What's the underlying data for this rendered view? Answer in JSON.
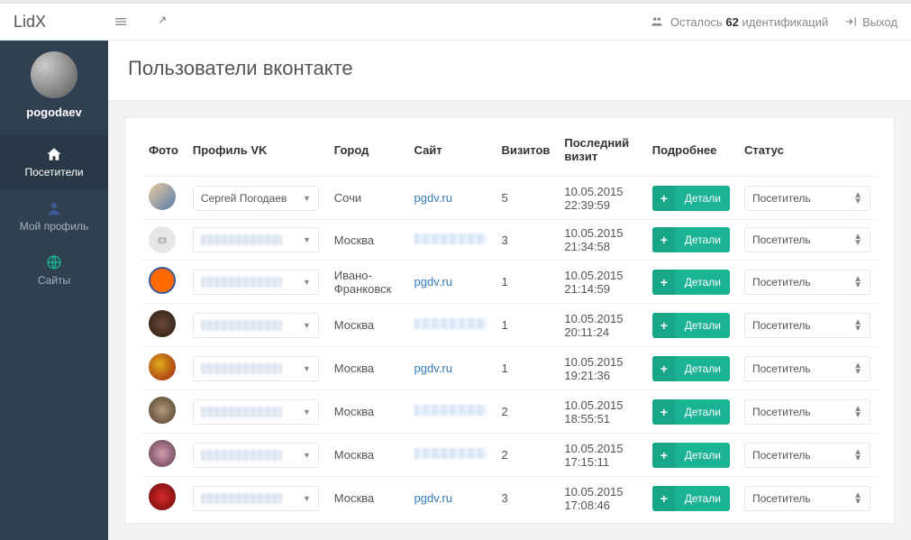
{
  "brand": "LidX",
  "topbar": {
    "remaining_prefix": "Осталось",
    "remaining_count": "62",
    "remaining_suffix": "идентификаций",
    "logout": "Выход"
  },
  "sidebar": {
    "username": "pogodaev",
    "items": [
      {
        "label": "Посетители"
      },
      {
        "label": "Мой профиль"
      },
      {
        "label": "Сайты"
      }
    ]
  },
  "page_title": "Пользователи вконтакте",
  "table": {
    "headers": {
      "photo": "Фото",
      "profile": "Профиль VK",
      "city": "Город",
      "site": "Сайт",
      "visits": "Визитов",
      "last_visit": "Последний визит",
      "more": "Подробнее",
      "status": "Статус"
    },
    "details_label": "Детали",
    "status_default": "Посетитель",
    "rows": [
      {
        "profile_name": "Сергей Погодаев",
        "city": "Сочи",
        "site": "pgdv.ru",
        "site_blur": false,
        "visits": "5",
        "last_visit": "10.05.2015 22:39:59"
      },
      {
        "profile_name": "",
        "city": "Москва",
        "site": "",
        "site_blur": true,
        "visits": "3",
        "last_visit": "10.05.2015 21:34:58"
      },
      {
        "profile_name": "",
        "city": "Ивано-Франковск",
        "site": "pgdv.ru",
        "site_blur": false,
        "visits": "1",
        "last_visit": "10.05.2015 21:14:59"
      },
      {
        "profile_name": "",
        "city": "Москва",
        "site": "",
        "site_blur": true,
        "visits": "1",
        "last_visit": "10.05.2015 20:11:24"
      },
      {
        "profile_name": "",
        "city": "Москва",
        "site": "pgdv.ru",
        "site_blur": false,
        "visits": "1",
        "last_visit": "10.05.2015 19:21:36"
      },
      {
        "profile_name": "",
        "city": "Москва",
        "site": "",
        "site_blur": true,
        "visits": "2",
        "last_visit": "10.05.2015 18:55:51"
      },
      {
        "profile_name": "",
        "city": "Москва",
        "site": "",
        "site_blur": true,
        "visits": "2",
        "last_visit": "10.05.2015 17:15:11"
      },
      {
        "profile_name": "",
        "city": "Москва",
        "site": "pgdv.ru",
        "site_blur": false,
        "visits": "3",
        "last_visit": "10.05.2015 17:08:46"
      }
    ]
  }
}
